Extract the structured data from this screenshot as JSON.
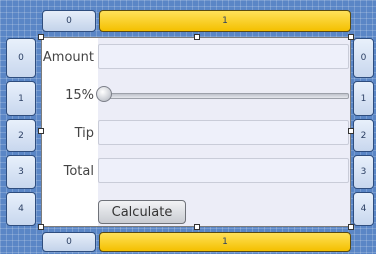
{
  "columns": {
    "top": [
      {
        "label": "0"
      },
      {
        "label": "1"
      }
    ],
    "bottom": [
      {
        "label": "0"
      },
      {
        "label": "1"
      }
    ]
  },
  "rows": {
    "left": [
      {
        "label": "0"
      },
      {
        "label": "1"
      },
      {
        "label": "2"
      },
      {
        "label": "3"
      },
      {
        "label": "4"
      }
    ],
    "right": [
      {
        "label": "0"
      },
      {
        "label": "1"
      },
      {
        "label": "2"
      },
      {
        "label": "3"
      },
      {
        "label": "4"
      }
    ]
  },
  "form": {
    "amount_label": "Amount",
    "amount_value": "",
    "percent_label": "15%",
    "tip_percent": 15,
    "tip_label": "Tip",
    "tip_value": "",
    "total_label": "Total",
    "total_value": "",
    "calculate_label": "Calculate"
  },
  "colors": {
    "canvas": "#5a86c6",
    "accent_tab": "#f4c000",
    "form_panel": "#ecedf7"
  }
}
